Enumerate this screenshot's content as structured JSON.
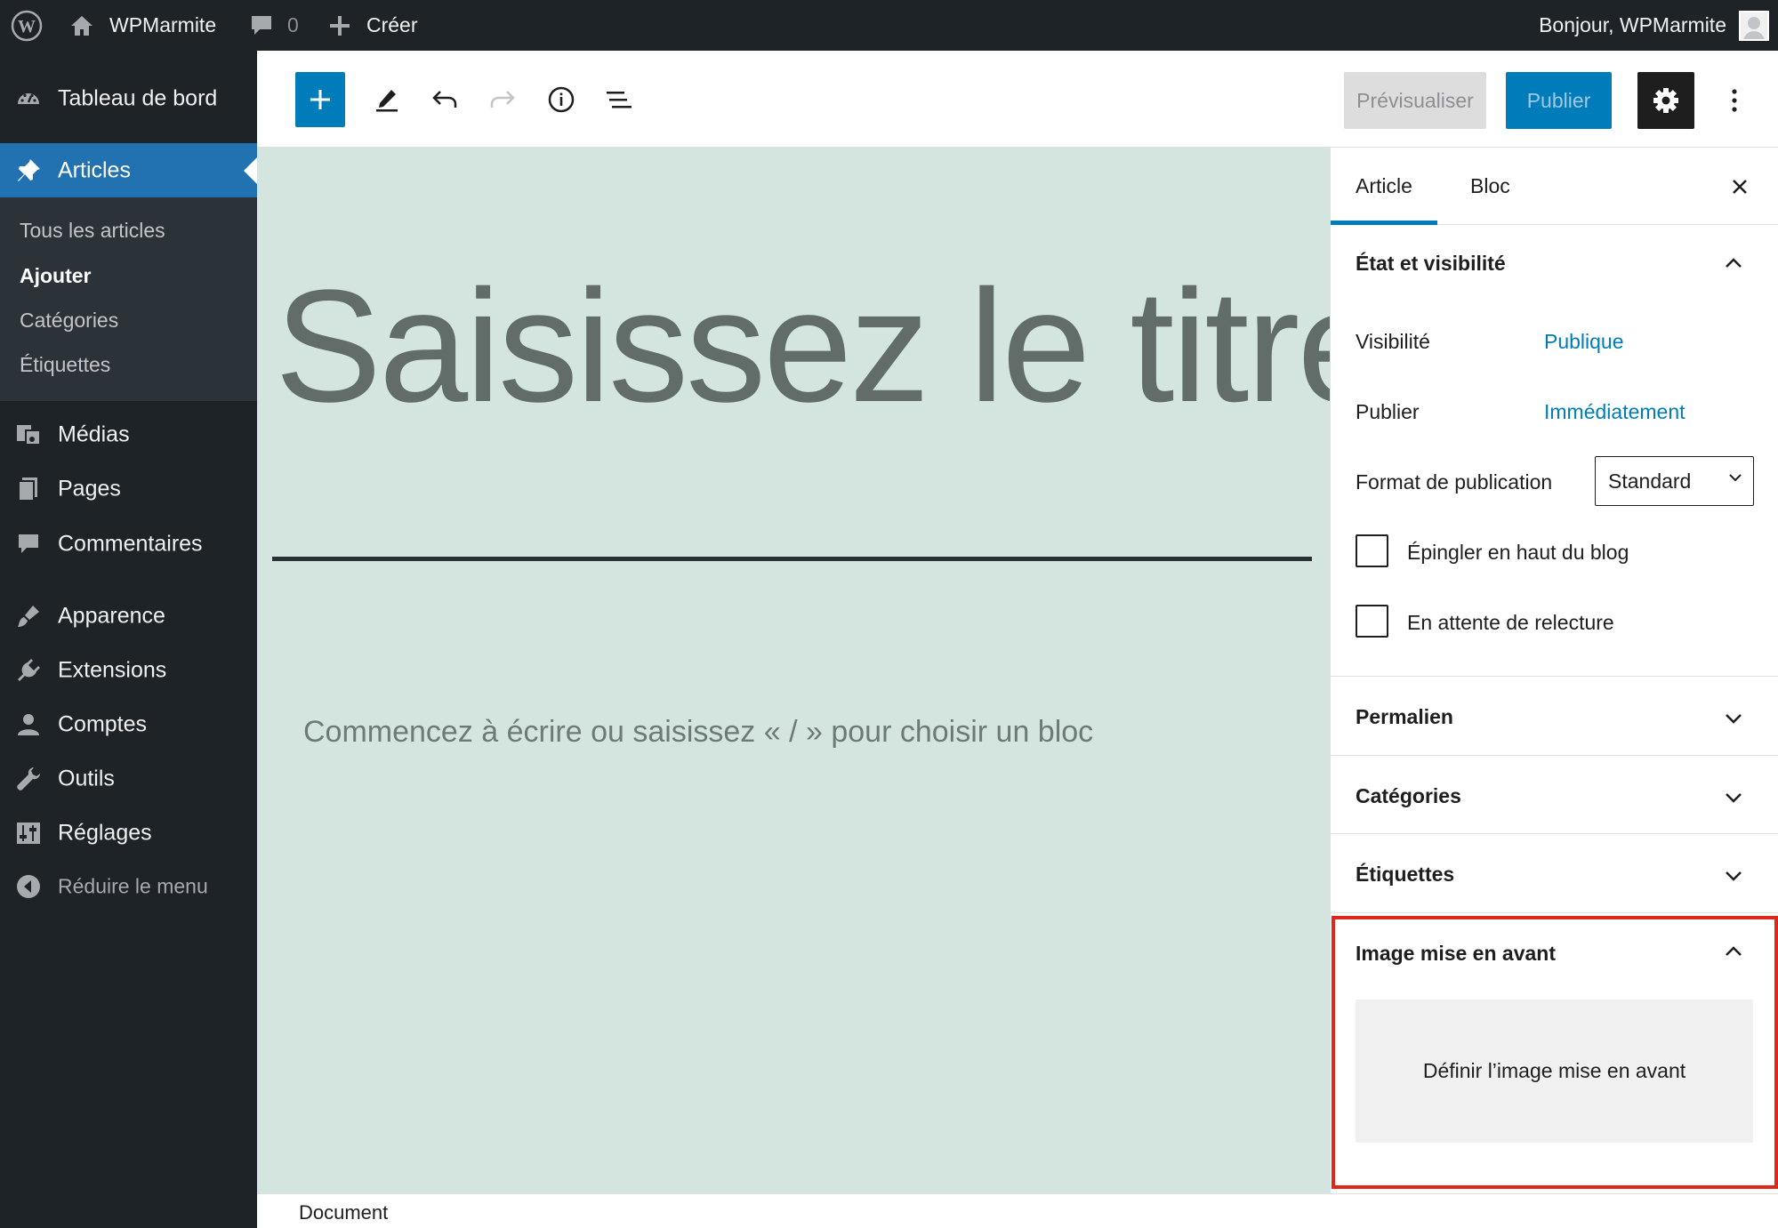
{
  "adminbar": {
    "site_name": "WPMarmite",
    "comment_count": "0",
    "new_label": "Créer",
    "greeting": "Bonjour, WPMarmite"
  },
  "sidebar": {
    "dashboard": "Tableau de bord",
    "articles": "Articles",
    "submenu": [
      "Tous les articles",
      "Ajouter",
      "Catégories",
      "Étiquettes"
    ],
    "current_submenu": "Ajouter",
    "items": [
      "Médias",
      "Pages",
      "Commentaires",
      "Apparence",
      "Extensions",
      "Comptes",
      "Outils",
      "Réglages"
    ],
    "collapse": "Réduire le menu"
  },
  "toolbar": {
    "preview": "Prévisualiser",
    "publish": "Publier"
  },
  "canvas": {
    "title_placeholder": "Saisissez le titre",
    "body_placeholder": "Commencez à écrire ou saisissez « / » pour choisir un bloc"
  },
  "panel": {
    "tabs": [
      "Article",
      "Bloc"
    ],
    "active_tab": "Article",
    "status": {
      "title": "État et visibilité",
      "visibility_label": "Visibilité",
      "visibility_value": "Publique",
      "publish_label": "Publier",
      "publish_value": "Immédiatement",
      "format_label": "Format de publication",
      "format_value": "Standard",
      "sticky_label": "Épingler en haut du blog",
      "pending_label": "En attente de relecture"
    },
    "sections": [
      "Permalien",
      "Catégories",
      "Étiquettes"
    ],
    "featured_image": {
      "title": "Image mise en avant",
      "button": "Définir l’image mise en avant"
    }
  },
  "footer": {
    "breadcrumb": "Document"
  },
  "colors": {
    "accent": "#007cba",
    "admin_dark": "#1d2327",
    "canvas_bg": "#d4e5df",
    "highlight": "#e0281a"
  }
}
